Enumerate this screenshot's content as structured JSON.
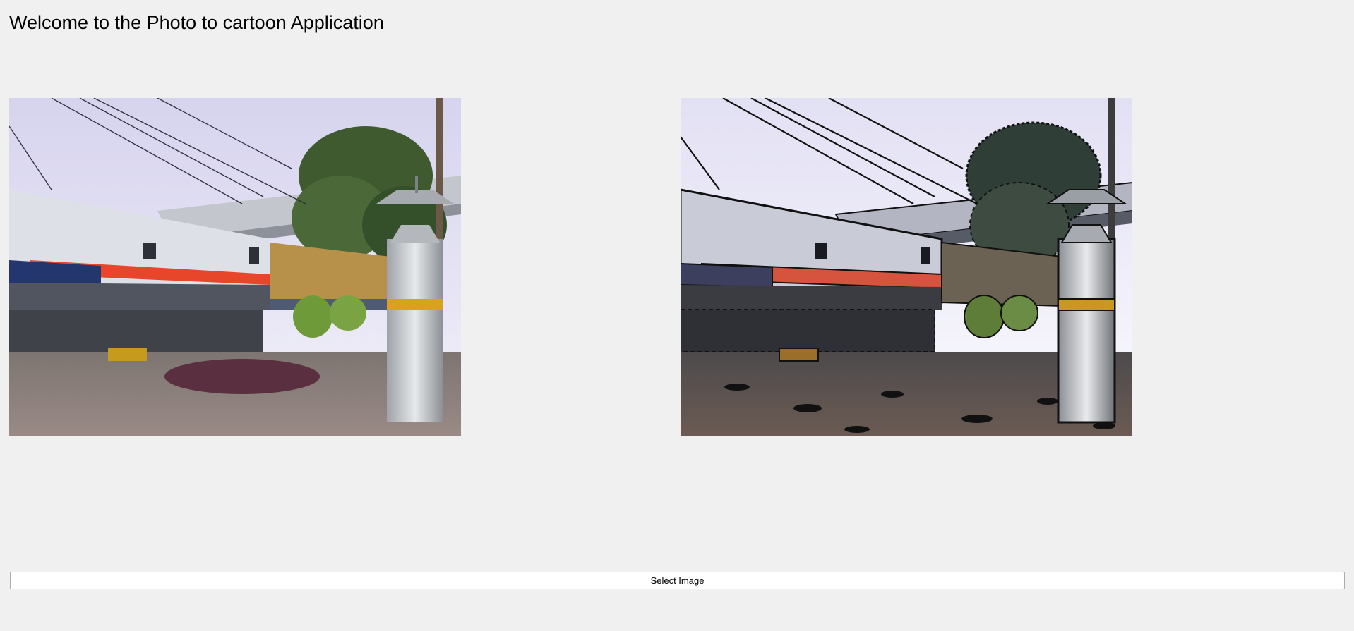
{
  "window": {
    "title": "Welcome to the Photo to cartoon Application"
  },
  "images": {
    "original": {
      "description_icon": "original-photo"
    },
    "cartoon": {
      "description_icon": "cartoonized-photo"
    }
  },
  "actions": {
    "select_image_label": "Select Image"
  },
  "colors": {
    "background": "#f0f0f0",
    "button_border": "#adadad",
    "button_bg": "#ffffff"
  }
}
